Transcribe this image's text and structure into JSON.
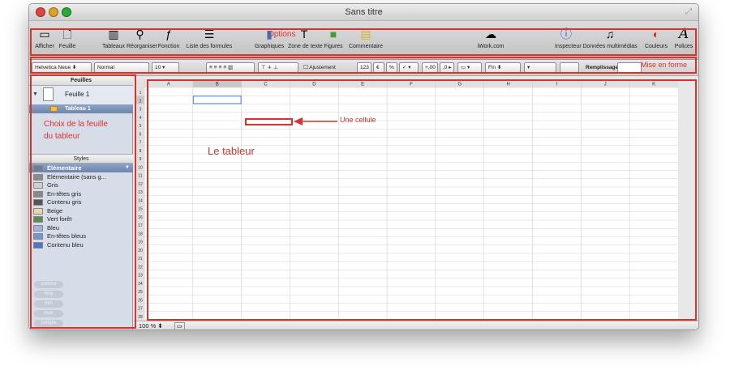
{
  "window": {
    "title": "Sans titre"
  },
  "toolbar": {
    "items": [
      {
        "label": "Afficher",
        "icon": "view-icon"
      },
      {
        "label": "Feuille",
        "icon": "sheet-icon"
      },
      {
        "label": "Tableaux",
        "icon": "table-icon"
      },
      {
        "label": "Réorganiser",
        "icon": "reorganize-icon"
      },
      {
        "label": "Fonction",
        "icon": "function-icon"
      },
      {
        "label": "Liste des formules",
        "icon": "formula-list-icon"
      },
      {
        "label": "Graphiques",
        "icon": "charts-icon"
      },
      {
        "label": "Zone de texte",
        "icon": "text-box-icon"
      },
      {
        "label": "Figures",
        "icon": "shapes-icon"
      },
      {
        "label": "Commentaire",
        "icon": "comment-icon"
      },
      {
        "label": "iWork.com",
        "icon": "iwork-icon"
      },
      {
        "label": "Inspecteur",
        "icon": "inspector-icon"
      },
      {
        "label": "Données multimédias",
        "icon": "media-icon"
      },
      {
        "label": "Couleurs",
        "icon": "colors-icon"
      },
      {
        "label": "Polices",
        "icon": "fonts-icon"
      }
    ]
  },
  "formatbar": {
    "font": "Helvetica Neue",
    "style": "Normal",
    "size": "10",
    "wrap_label": "Ajustement",
    "num_currency": "123",
    "num_euro": "€",
    "num_percent": "%",
    "num_check": "✓",
    "dec_inc": "+,00",
    "dec_dec": ",0",
    "border_style": "Fin",
    "fill_label": "Remplissage :"
  },
  "sidebar": {
    "sheets_header": "Feuilles",
    "sheet_name": "Feuille 1",
    "table_name": "Tableau 1",
    "styles_header": "Styles",
    "styles": [
      {
        "label": "Élémentaire"
      },
      {
        "label": "Elémentaire (sans g..."
      },
      {
        "label": "Gris"
      },
      {
        "label": "En-têtes gris"
      },
      {
        "label": "Contenu gris"
      },
      {
        "label": "Beige"
      },
      {
        "label": "Vert forêt"
      },
      {
        "label": "Bleu"
      },
      {
        "label": "En-têtes bleus"
      },
      {
        "label": "Contenu bleu"
      }
    ],
    "pills": [
      "somme",
      "moy",
      "min",
      "max",
      "compte"
    ]
  },
  "grid": {
    "columns": [
      "A",
      "B",
      "C",
      "D",
      "E",
      "F",
      "G",
      "H",
      "I",
      "J",
      "K"
    ],
    "row_count": 28
  },
  "zoom": {
    "value": "100 %"
  },
  "annotations": {
    "options": "Options",
    "mise_en_forme": "Mise en forme",
    "choix_line1": "Choix de la feuille",
    "choix_line2": "du tableur",
    "le_tableur": "Le tableur",
    "une_cellule": "Une cellule"
  },
  "colors": {
    "annotation": "#d9332f",
    "selection": "#4a7fd6",
    "table_header": "#6c84ad"
  }
}
